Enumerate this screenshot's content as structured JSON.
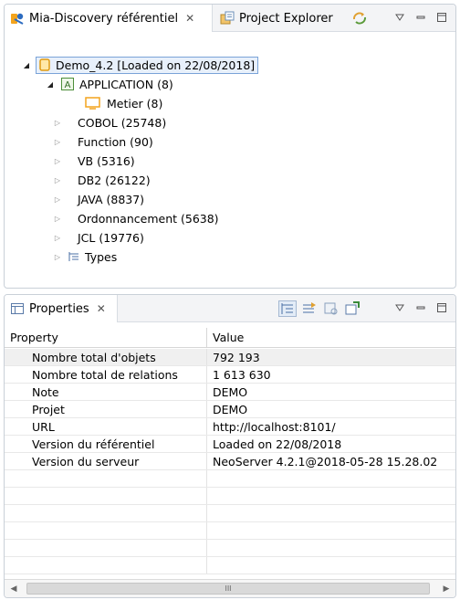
{
  "top_view": {
    "tabs": [
      {
        "label": "Mia-Discovery référentiel",
        "close": "✕",
        "icon": "mia-discovery-icon"
      },
      {
        "label": "Project Explorer",
        "icon": "project-explorer-icon"
      }
    ],
    "toolbar_icons": [
      "sync-icon",
      "view-menu-icon",
      "minimize-icon",
      "maximize-icon"
    ],
    "tree": {
      "root": {
        "label": "Demo_4.2 [Loaded on 22/08/2018]",
        "icon": "database-icon",
        "expanded": true
      },
      "application": {
        "label": "APPLICATION (8)",
        "icon": "application-icon",
        "expanded": true
      },
      "metier": {
        "label": "Metier (8)",
        "icon": "folder-icon"
      },
      "items": [
        {
          "label": "COBOL (25748)"
        },
        {
          "label": "Function (90)"
        },
        {
          "label": "VB (5316)"
        },
        {
          "label": "DB2 (26122)"
        },
        {
          "label": "JAVA (8837)"
        },
        {
          "label": "Ordonnancement (5638)"
        },
        {
          "label": "JCL (19776)"
        }
      ],
      "types": {
        "label": "Types",
        "icon": "types-icon"
      }
    }
  },
  "properties_view": {
    "tab": {
      "label": "Properties",
      "close": "✕",
      "icon": "properties-icon"
    },
    "toolbar_icons": [
      "show-categories-icon",
      "show-advanced-icon",
      "filter-icon",
      "pin-icon",
      "view-menu-icon",
      "minimize-icon",
      "maximize-icon"
    ],
    "columns": {
      "property": "Property",
      "value": "Value"
    },
    "rows": [
      {
        "property": "Nombre total d'objets",
        "value": "792 193"
      },
      {
        "property": "Nombre total de relations",
        "value": "1 613 630"
      },
      {
        "property": "Note",
        "value": "DEMO"
      },
      {
        "property": "Projet",
        "value": "DEMO"
      },
      {
        "property": "URL",
        "value": "http://localhost:8101/"
      },
      {
        "property": "Version du référentiel",
        "value": "Loaded on 22/08/2018"
      },
      {
        "property": "Version du serveur",
        "value": "NeoServer 4.2.1@2018-05-28 15.28.02"
      }
    ],
    "scrollbar": {
      "left": "◀",
      "right": "▶",
      "grip": "III"
    }
  },
  "colors": {
    "selection_border": "#7aa3d8",
    "selection_fill": "#e8f0fb",
    "orange": "#f3a41d"
  }
}
